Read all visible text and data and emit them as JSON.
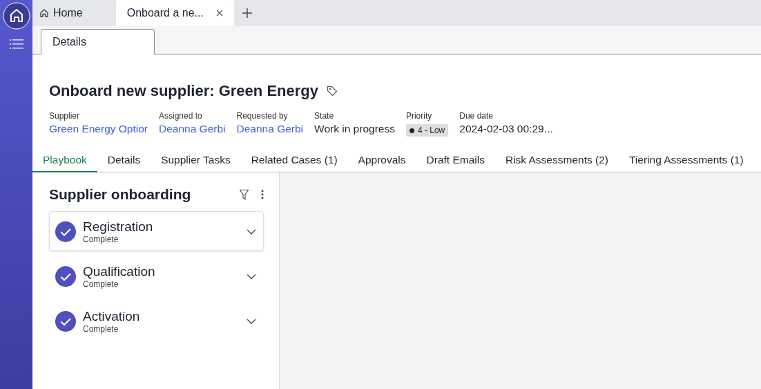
{
  "browser_tabs": [
    {
      "label": "Home",
      "selected": false,
      "kind": "home"
    },
    {
      "label": "Onboard a ne...",
      "selected": true,
      "kind": "record"
    }
  ],
  "form_tabs": [
    {
      "label": "Details",
      "selected": true
    }
  ],
  "record": {
    "title": "Onboard new supplier: Green Energy",
    "fields": [
      {
        "label": "Supplier",
        "value": "Green Energy Optior",
        "kind": "link"
      },
      {
        "label": "Assigned to",
        "value": "Deanna Gerbi",
        "kind": "link"
      },
      {
        "label": "Requested by",
        "value": "Deanna Gerbi",
        "kind": "link"
      },
      {
        "label": "State",
        "value": "Work in progress",
        "kind": "text"
      },
      {
        "label": "Priority",
        "value": "4 - Low",
        "kind": "badge"
      },
      {
        "label": "Due date",
        "value": "2024-02-03 00:29...",
        "kind": "text"
      }
    ]
  },
  "tabs": [
    {
      "label": "Playbook",
      "selected": true
    },
    {
      "label": "Details",
      "selected": false
    },
    {
      "label": "Supplier Tasks",
      "selected": false
    },
    {
      "label": "Related Cases (1)",
      "selected": false
    },
    {
      "label": "Approvals",
      "selected": false
    },
    {
      "label": "Draft Emails",
      "selected": false
    },
    {
      "label": "Risk Assessments (2)",
      "selected": false
    },
    {
      "label": "Tiering Assessments (1)",
      "selected": false
    }
  ],
  "playbook": {
    "title": "Supplier onboarding",
    "stages": [
      {
        "name": "Registration",
        "status": "Complete",
        "selected": true,
        "checked": true
      },
      {
        "name": "Qualification",
        "status": "Complete",
        "selected": false,
        "checked": true
      },
      {
        "name": "Activation",
        "status": "Complete",
        "selected": false,
        "checked": true
      }
    ]
  }
}
